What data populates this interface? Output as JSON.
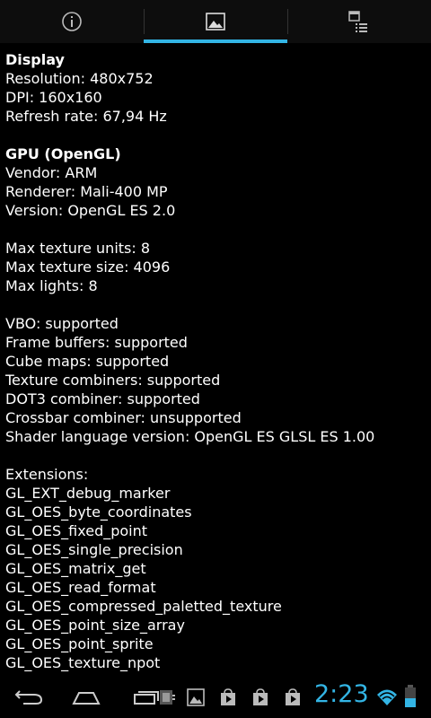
{
  "tabs": [
    {
      "name": "info",
      "icon": "info-icon",
      "active": false
    },
    {
      "name": "gpu",
      "icon": "image-icon",
      "active": true
    },
    {
      "name": "features",
      "icon": "calendar-list-icon",
      "active": false
    }
  ],
  "lines": [
    {
      "text": "Display",
      "bold": true
    },
    {
      "text": "Resolution: 480x752"
    },
    {
      "text": "DPI: 160x160"
    },
    {
      "text": "Refresh rate: 67,94 Hz"
    },
    {
      "text": ""
    },
    {
      "text": "GPU (OpenGL)",
      "bold": true
    },
    {
      "text": "Vendor: ARM"
    },
    {
      "text": "Renderer: Mali-400 MP"
    },
    {
      "text": "Version: OpenGL ES 2.0"
    },
    {
      "text": ""
    },
    {
      "text": "Max texture units: 8"
    },
    {
      "text": "Max texture size: 4096"
    },
    {
      "text": "Max lights: 8"
    },
    {
      "text": ""
    },
    {
      "text": "VBO: supported"
    },
    {
      "text": "Frame buffers: supported"
    },
    {
      "text": "Cube maps: supported"
    },
    {
      "text": "Texture combiners: supported"
    },
    {
      "text": "DOT3 combiner: supported"
    },
    {
      "text": "Crossbar combiner: unsupported"
    },
    {
      "text": "Shader language version: OpenGL ES GLSL ES 1.00"
    },
    {
      "text": ""
    },
    {
      "text": "Extensions:"
    },
    {
      "text": "GL_EXT_debug_marker"
    },
    {
      "text": "GL_OES_byte_coordinates"
    },
    {
      "text": "GL_OES_fixed_point"
    },
    {
      "text": "GL_OES_single_precision"
    },
    {
      "text": "GL_OES_matrix_get"
    },
    {
      "text": "GL_OES_read_format"
    },
    {
      "text": "GL_OES_compressed_paletted_texture"
    },
    {
      "text": "GL_OES_point_size_array"
    },
    {
      "text": "GL_OES_point_sprite"
    },
    {
      "text": "GL_OES_texture_npot"
    }
  ],
  "status": {
    "time": "2:23"
  },
  "colors": {
    "accent": "#33b5e5"
  }
}
